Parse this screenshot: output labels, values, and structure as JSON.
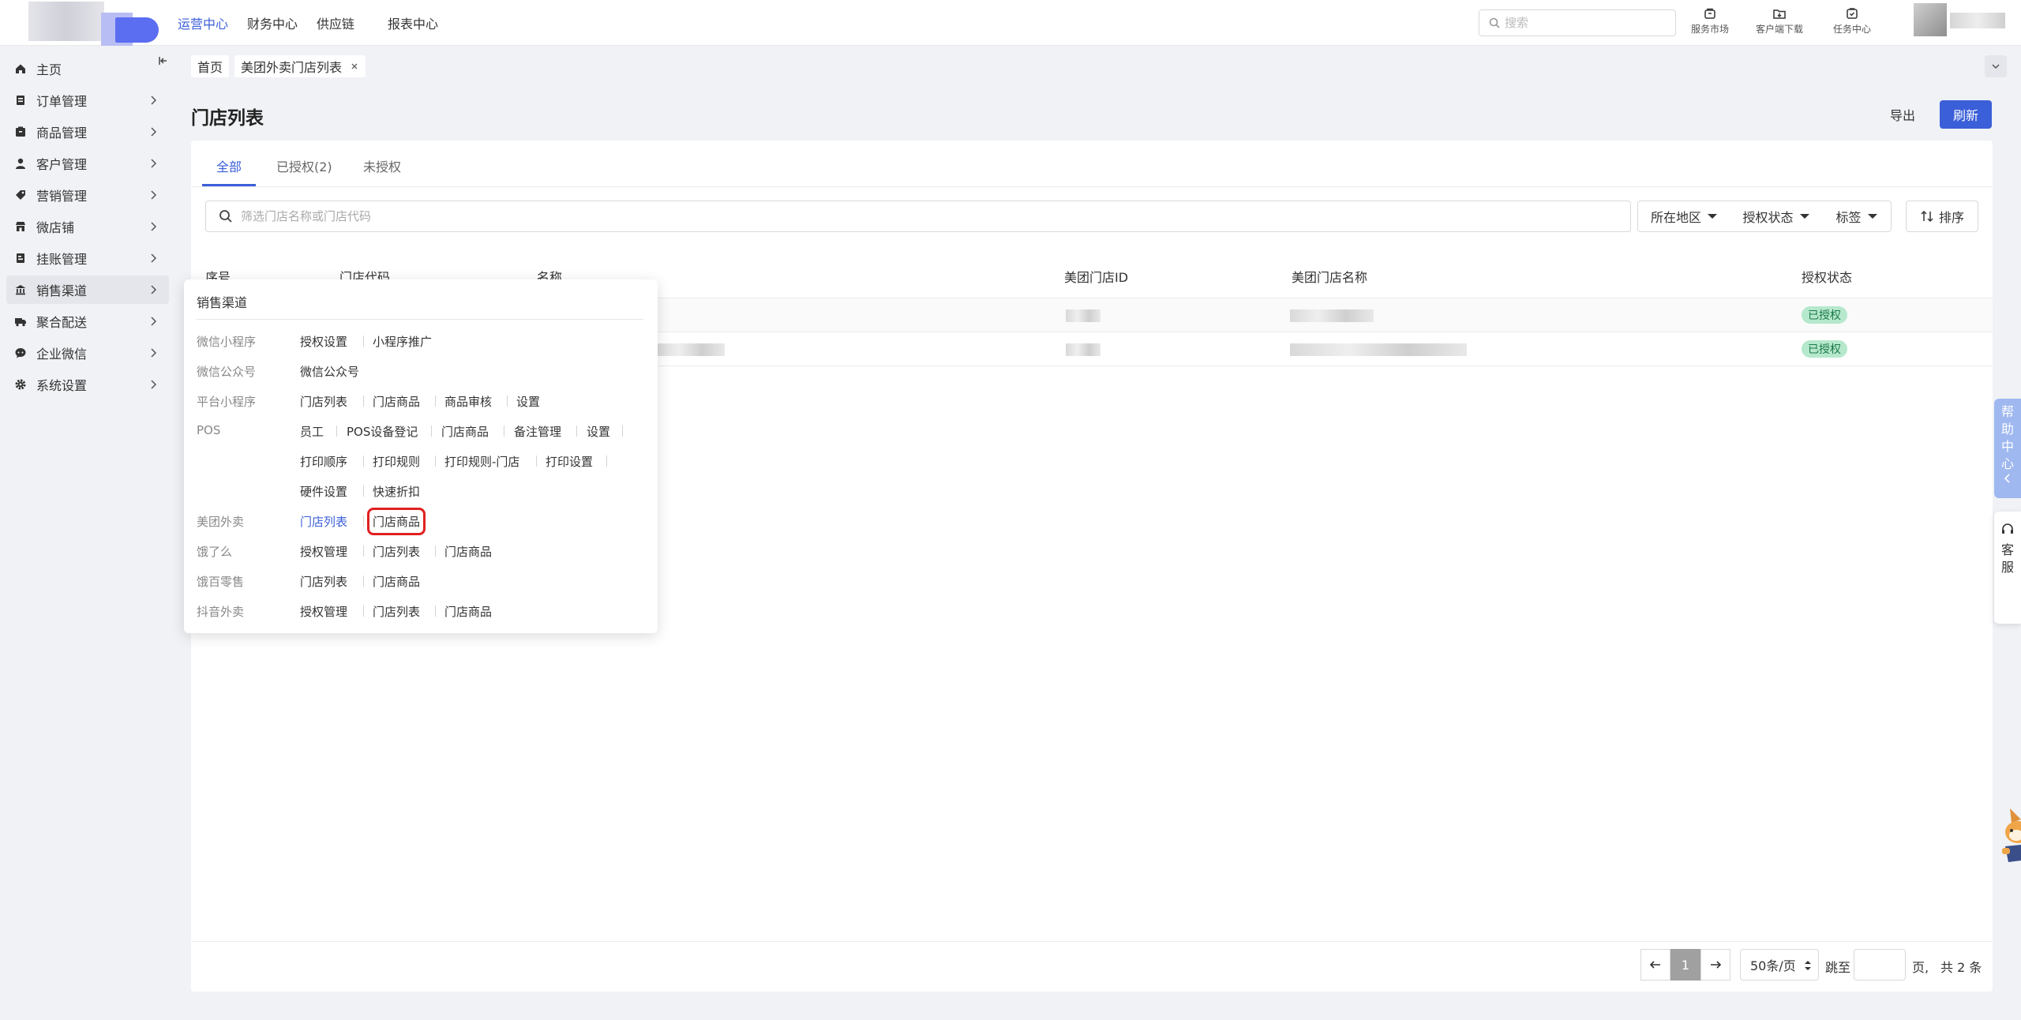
{
  "topnav": {
    "items": [
      "运营中心",
      "财务中心",
      "供应链",
      "报表中心"
    ],
    "active_index": 0,
    "search_placeholder": "搜索",
    "tools": [
      "服务市场",
      "客户端下载",
      "任务中心"
    ]
  },
  "sidebar": {
    "items": [
      "主页",
      "订单管理",
      "商品管理",
      "客户管理",
      "营销管理",
      "微店铺",
      "挂账管理",
      "销售渠道",
      "聚合配送",
      "企业微信",
      "系统设置"
    ],
    "active_index": 7
  },
  "tabstrip": {
    "home": "首页",
    "current": "美团外卖门店列表"
  },
  "page": {
    "title": "门店列表",
    "export_label": "导出",
    "refresh_label": "刷新"
  },
  "content_tabs": [
    "全部",
    "已授权(2)",
    "未授权"
  ],
  "filters": {
    "search_placeholder": "筛选门店名称或门店代码",
    "region": "所在地区",
    "auth_status": "授权状态",
    "tag": "标签",
    "sort": "排序"
  },
  "table": {
    "headers": [
      "序号",
      "门店代码",
      "名称",
      "美团门店ID",
      "美团门店名称",
      "授权状态"
    ],
    "rows": [
      {
        "status": "已授权"
      },
      {
        "status": "已授权"
      }
    ]
  },
  "pagination": {
    "current": "1",
    "page_size": "50条/页",
    "jump_label": "跳至",
    "page_unit": "页,",
    "total": "共 2 条"
  },
  "menu_panel": {
    "title": "销售渠道",
    "groups": [
      {
        "label": "微信小程序",
        "links": [
          "授权设置",
          "小程序推广"
        ]
      },
      {
        "label": "微信公众号",
        "links": [
          "微信公众号"
        ]
      },
      {
        "label": "平台小程序",
        "links": [
          "门店列表",
          "门店商品",
          "商品审核",
          "设置"
        ]
      },
      {
        "label": "POS",
        "links": [
          "员工",
          "POS设备登记",
          "门店商品",
          "备注管理",
          "设置",
          "打印顺序",
          "打印规则",
          "打印规则-门店",
          "打印设置",
          "硬件设置",
          "快速折扣"
        ]
      },
      {
        "label": "美团外卖",
        "links": [
          "门店列表",
          "门店商品"
        ]
      },
      {
        "label": "饿了么",
        "links": [
          "授权管理",
          "门店列表",
          "门店商品"
        ]
      },
      {
        "label": "饿百零售",
        "links": [
          "门店列表",
          "门店商品"
        ]
      },
      {
        "label": "抖音外卖",
        "links": [
          "授权管理",
          "门店列表",
          "门店商品"
        ]
      }
    ]
  },
  "float": {
    "help": [
      "帮",
      "助",
      "中",
      "心"
    ],
    "service": [
      "客",
      "服"
    ]
  },
  "colors": {
    "accent": "#3b5fd9",
    "badge_bg": "#b5e8cc",
    "badge_text": "#1d7a48",
    "highlight": "#e02020"
  }
}
